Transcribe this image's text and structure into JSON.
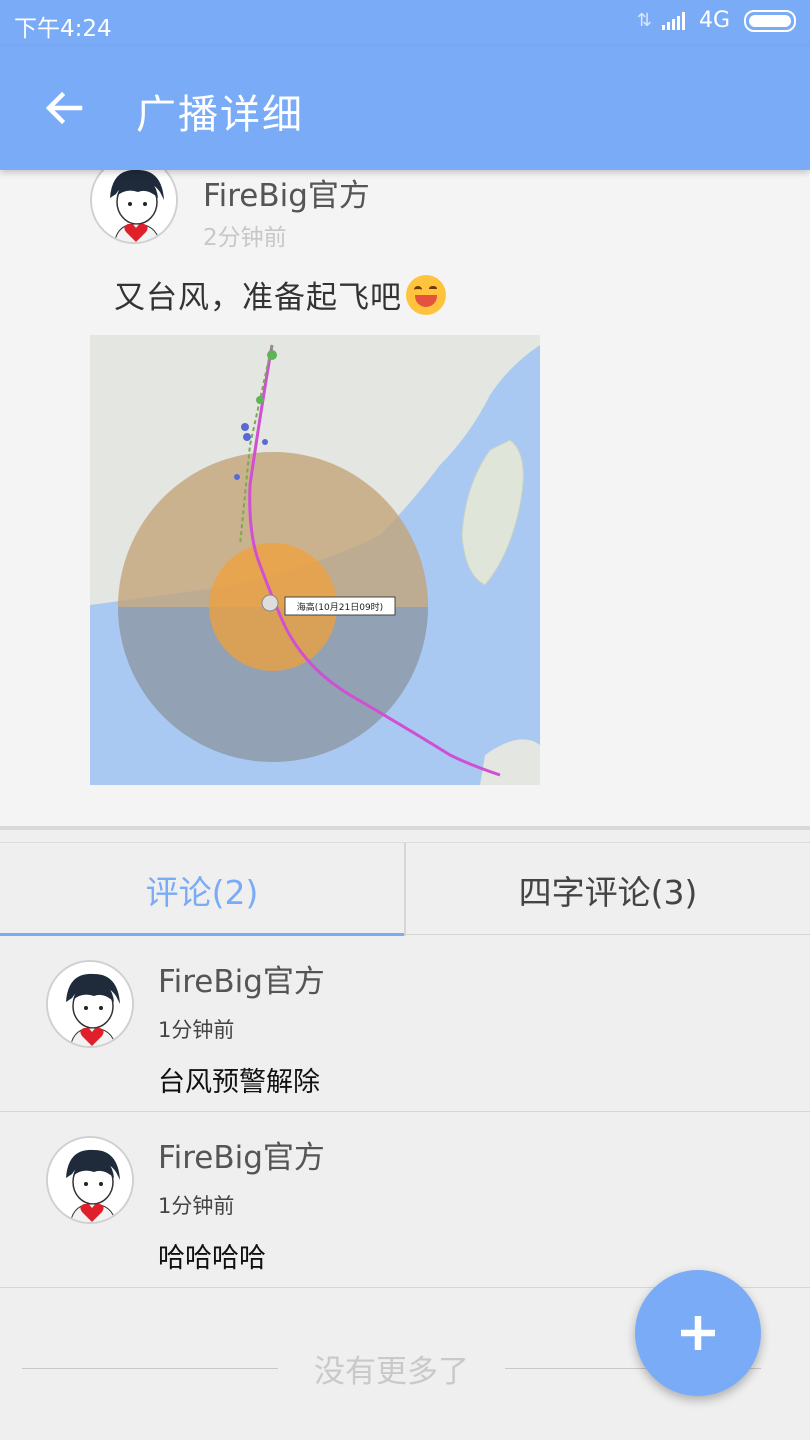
{
  "status_bar": {
    "time": "下午4:24",
    "network": "4G"
  },
  "toolbar": {
    "title": "广播详细",
    "back_icon": "arrow-left-icon"
  },
  "post": {
    "author": "FireBig官方",
    "time": "2分钟前",
    "content": "又台风，准备起飞吧",
    "emoji": "smiling-face-icon",
    "map_label": "海高(10月21日09时)"
  },
  "tabs": [
    {
      "label": "评论(2)",
      "active": true
    },
    {
      "label": "四字评论(3)",
      "active": false
    }
  ],
  "comments": [
    {
      "name": "FireBig官方",
      "time": "1分钟前",
      "text": "台风预警解除"
    },
    {
      "name": "FireBig官方",
      "time": "1分钟前",
      "text": "哈哈哈哈"
    }
  ],
  "footer": {
    "no_more": "没有更多了"
  },
  "fab": {
    "icon": "plus-icon"
  },
  "colors": {
    "primary": "#7aabf7",
    "background": "#efefef"
  }
}
